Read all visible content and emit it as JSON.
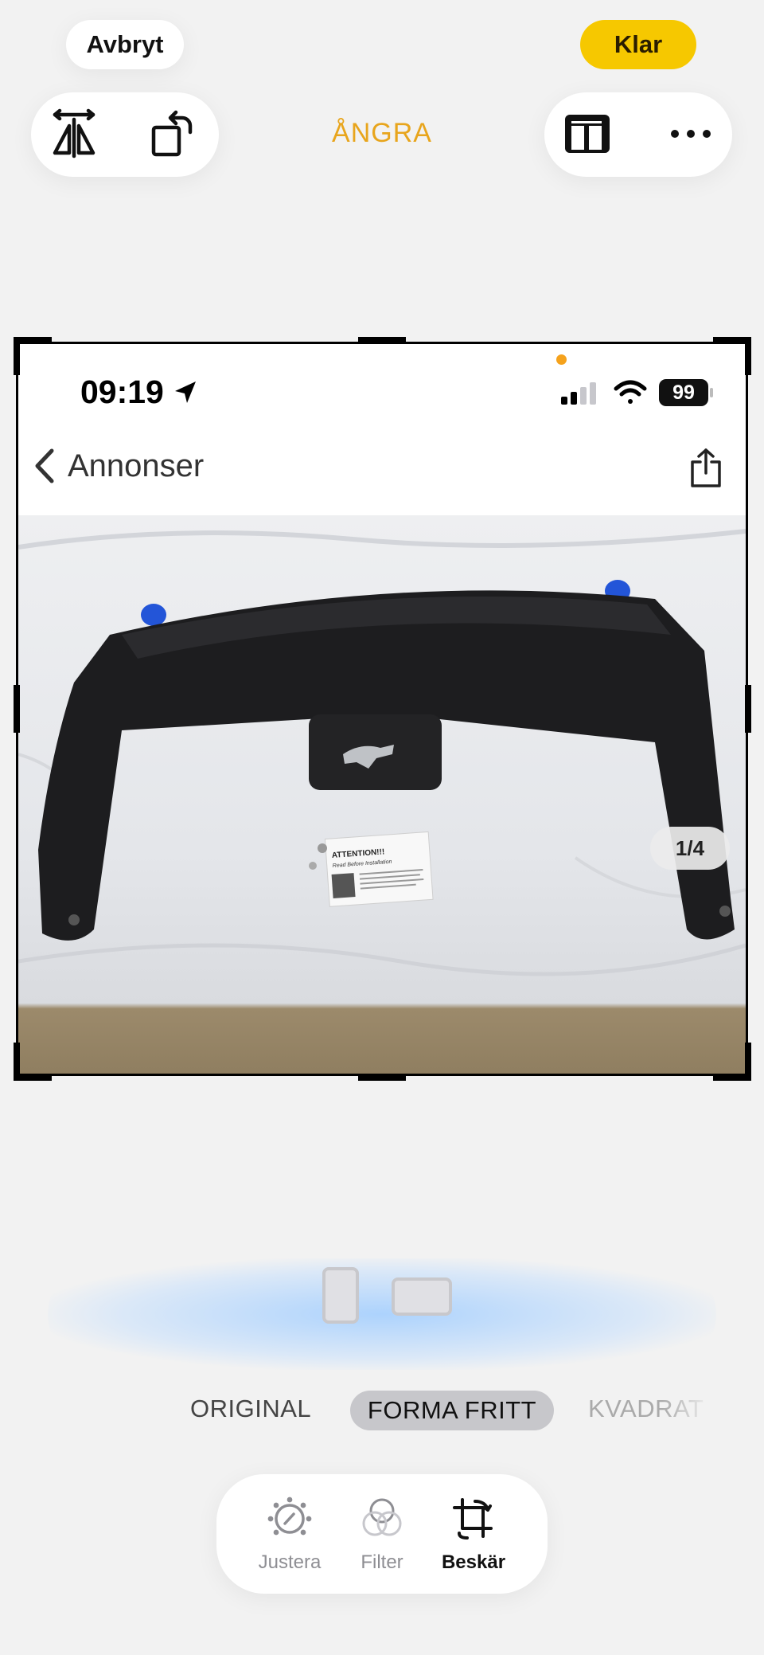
{
  "header": {
    "cancel_label": "Avbryt",
    "done_label": "Klar",
    "undo_label": "ÅNGRA",
    "accent_color": "#f6c800",
    "undo_color": "#e8a51c"
  },
  "toolbar": {
    "left_icons": [
      "flip-horizontal-icon",
      "rotate-icon"
    ],
    "right_icons": [
      "aspect-ratio-icon",
      "more-icon"
    ]
  },
  "screenshot": {
    "time": "09:19",
    "battery": "99",
    "back_label": "Annonser",
    "page_indicator": "1/4",
    "photo_note_title": "ATTENTION!!!",
    "photo_note_subtitle": "Read Before Installation"
  },
  "aspect": {
    "presets": [
      "ORIGINAL",
      "FORMA FRITT",
      "KVADRAT"
    ],
    "selected": "FORMA FRITT"
  },
  "tabs": {
    "items": [
      {
        "label": "Justera",
        "icon": "adjust-icon"
      },
      {
        "label": "Filter",
        "icon": "filter-icon"
      },
      {
        "label": "Beskär",
        "icon": "crop-icon"
      }
    ],
    "active": "Beskär"
  }
}
